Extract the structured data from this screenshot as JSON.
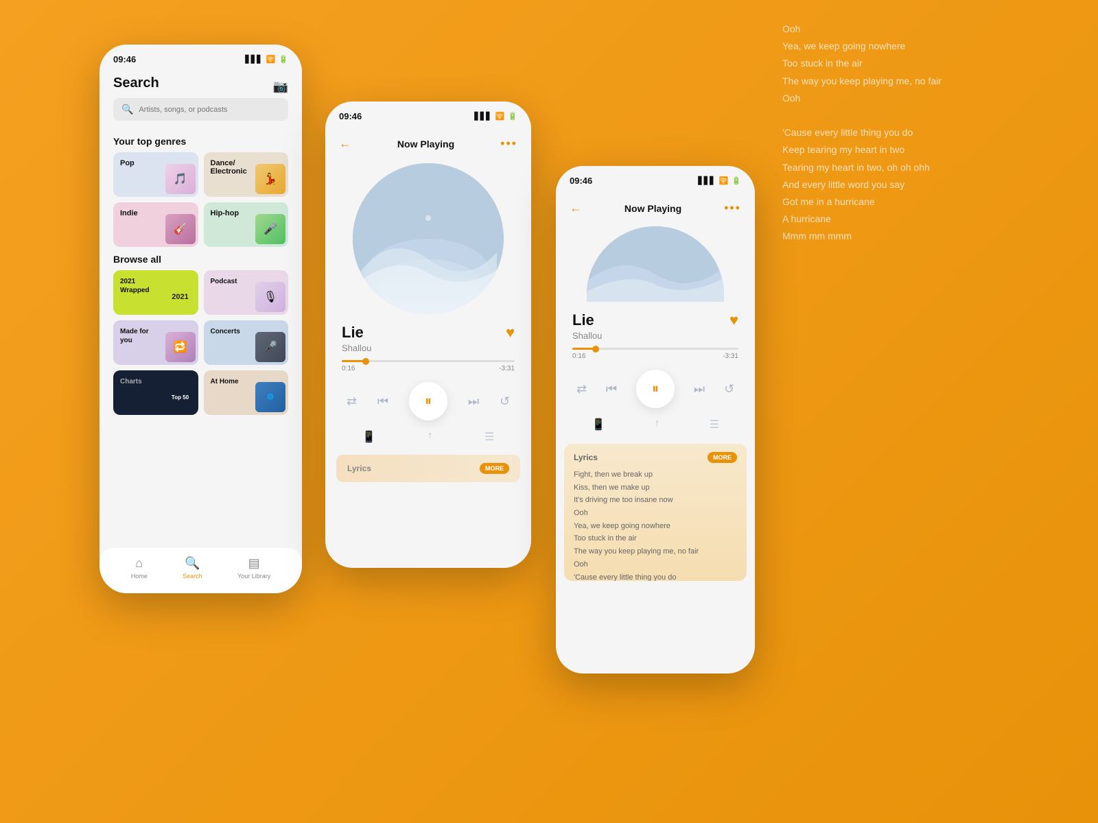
{
  "bg": {
    "lyrics_lines": [
      "Ooh",
      "Yea, we keep going nowhere",
      "Too stuck in the air",
      "The way you keep playing me, no fair",
      "Ooh",
      "",
      "'Cause every little thing you do",
      "Keep tearing my heart in two",
      "Tearing my heart in two, oh oh ohh",
      "And every little word you say",
      "Got me in a hurricane",
      "A hurricane",
      "Mmm mm mmm"
    ]
  },
  "phone_search": {
    "status_time": "09:46",
    "title": "Search",
    "search_placeholder": "Artists, songs, or podcasts",
    "top_genres_title": "Your top genres",
    "genres": [
      {
        "name": "Pop",
        "style": "pop"
      },
      {
        "name": "Dance/ Electronic",
        "style": "dance"
      },
      {
        "name": "Indie",
        "style": "indie"
      },
      {
        "name": "Hip-hop",
        "style": "hiphop"
      }
    ],
    "browse_title": "Browse all",
    "browse_items": [
      {
        "name": "2021 Wrapped",
        "style": "wrapped"
      },
      {
        "name": "Podcast",
        "style": "podcast"
      },
      {
        "name": "Made for you",
        "style": "madeforyou"
      },
      {
        "name": "Concerts",
        "style": "concerts"
      },
      {
        "name": "Charts",
        "style": "charts"
      },
      {
        "name": "At Home",
        "style": "athome"
      }
    ],
    "nav": [
      {
        "label": "Home",
        "icon": "⌂",
        "active": false
      },
      {
        "label": "Search",
        "icon": "⌕",
        "active": true
      },
      {
        "label": "Your Library",
        "icon": "▤",
        "active": false
      }
    ]
  },
  "phone_now_playing": {
    "status_time": "09:46",
    "title": "Now Playing",
    "track_name": "Lie",
    "track_artist": "Shallou",
    "time_current": "0:16",
    "time_total": "-3:31",
    "lyrics_label": "Lyrics",
    "more_label": "MORE"
  },
  "phone_expanded": {
    "status_time": "09:46",
    "title": "Now Playing",
    "track_name": "Lie",
    "track_artist": "Shallou",
    "time_current": "0:16",
    "time_total": "-3:31",
    "lyrics_label": "Lyrics",
    "more_label": "MORE",
    "lyrics_lines": [
      "Fight, then we break up",
      "Kiss, then we make up",
      "It's driving me too insane now",
      "Ooh",
      "Yea, we keep going nowhere",
      "Too stuck in the air",
      "The way you keep playing me, no fair",
      "Ooh",
      "'Cause every little thing you do"
    ]
  }
}
